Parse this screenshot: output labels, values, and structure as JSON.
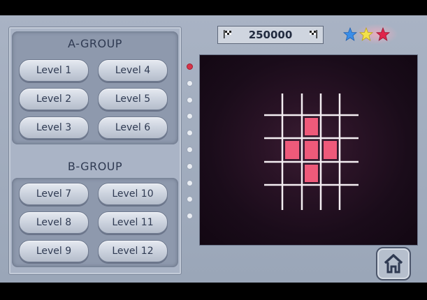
{
  "groups": {
    "a": {
      "title": "A-GROUP",
      "levels": [
        "Level 1",
        "Level 2",
        "Level 3",
        "Level 4",
        "Level 5",
        "Level 6"
      ]
    },
    "b": {
      "title": "B-GROUP",
      "levels": [
        "Level 7",
        "Level 8",
        "Level 9",
        "Level 10",
        "Level 11",
        "Level 12"
      ]
    }
  },
  "score": "250000",
  "stars": [
    "blue",
    "yellow",
    "red"
  ],
  "colors": {
    "star_blue": "#3a8ee8",
    "star_yellow": "#f2e14a",
    "star_red": "#e0244a",
    "cell_fill": "#ee5a7a",
    "grid_line": "#f4eef2",
    "active_dot": "#d8334a"
  },
  "stage_dots": {
    "count": 10,
    "active_index": 0
  },
  "preview": {
    "grid_rows": 4,
    "grid_cols": 4,
    "filled_cells": [
      [
        1,
        1
      ],
      [
        2,
        0
      ],
      [
        2,
        1
      ],
      [
        2,
        2
      ],
      [
        3,
        1
      ]
    ]
  }
}
